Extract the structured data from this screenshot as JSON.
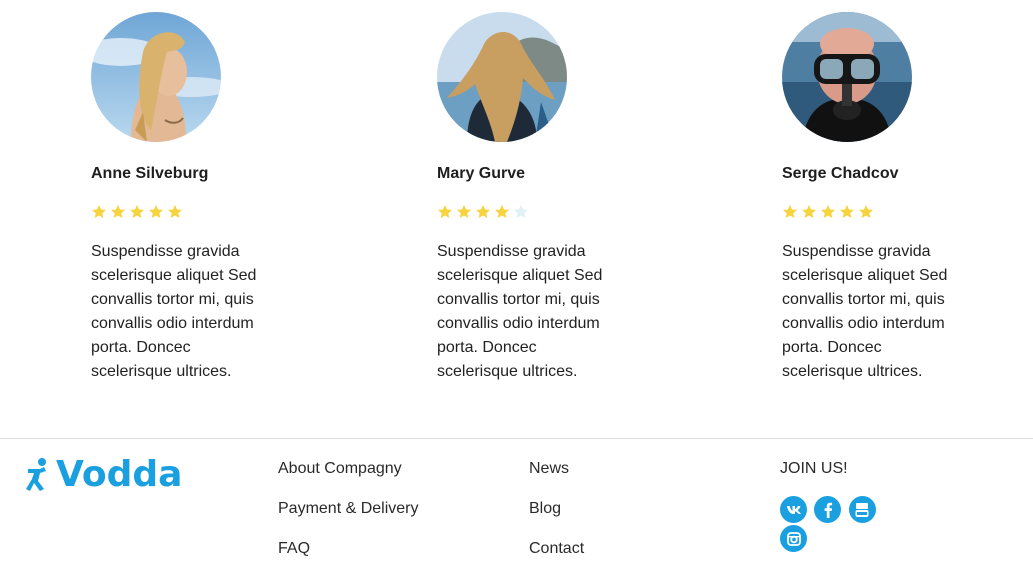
{
  "reviews": [
    {
      "name": "Anne Silveburg",
      "rating": 5,
      "max_rating": 5,
      "text": "Suspendisse gravida scelerisque aliquet Sed convallis tortor mi, quis convallis odio interdum porta. Doncec scelerisque ultrices."
    },
    {
      "name": "Mary Gurve",
      "rating": 4,
      "max_rating": 5,
      "text": "Suspendisse gravida scelerisque aliquet Sed convallis tortor mi, quis convallis odio interdum porta. Doncec scelerisque ultrices."
    },
    {
      "name": "Serge Chadcov",
      "rating": 5,
      "max_rating": 5,
      "text": "Suspendisse gravida scelerisque aliquet Sed convallis tortor mi, quis convallis odio interdum porta. Doncec scelerisque ultrices."
    }
  ],
  "footer": {
    "logo_text": "Vodda",
    "col1": [
      "About Compagny",
      "Payment & Delivery",
      "FAQ"
    ],
    "col2": [
      "News",
      "Blog",
      "Contact"
    ],
    "join_label": "JOIN US!",
    "social": [
      "vk-icon",
      "facebook-icon",
      "youtube-icon",
      "instagram-icon"
    ]
  },
  "colors": {
    "accent": "#1aa0e0",
    "star_filled": "#f7d33f",
    "star_empty": "#dff0f7"
  }
}
